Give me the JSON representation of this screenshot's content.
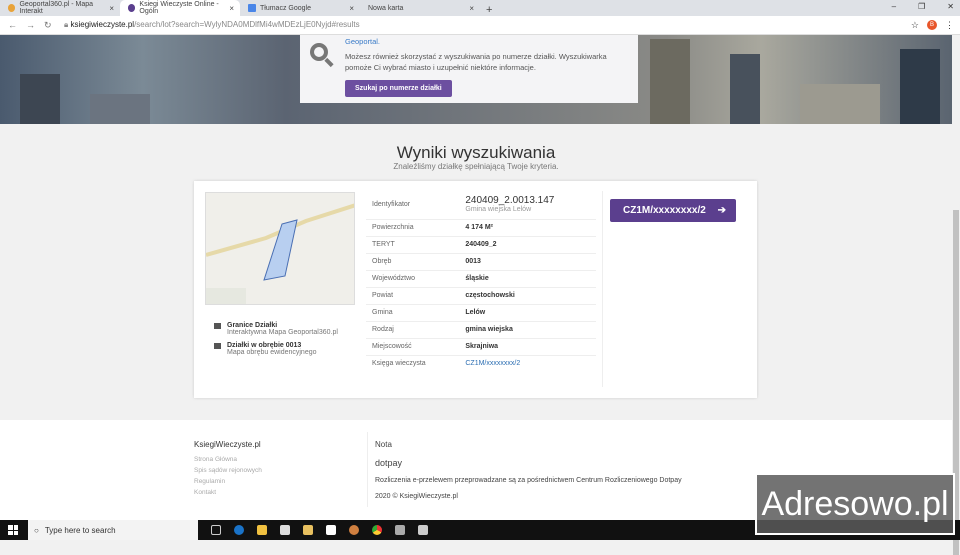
{
  "browser": {
    "tabs": [
      {
        "label": "Geoportal360.pl - Mapa Interakt",
        "favicon_color": "#e8a33a"
      },
      {
        "label": "Ksiegi Wieczyste Online - Ogóln",
        "favicon_color": "#5b3f8e"
      },
      {
        "label": "Tłumacz Google",
        "favicon_color": "#4a86e8"
      },
      {
        "label": "Nowa karta",
        "favicon_color": ""
      }
    ],
    "url_domain": "ksiegiwieczyste.pl",
    "url_path": "/search/lot?search=WylyNDA0MDlfMi4wMDEzLjE0Nyjd#results",
    "avatar": "B"
  },
  "search_box": {
    "geoportal_link": "Geoportal.",
    "text": "Możesz również skorzystać z wyszukiwania po numerze działki. Wyszukiwarka pomoże Ci wybrać miasto i uzupełnić niektóre informacje.",
    "button": "Szukaj po numerze działki"
  },
  "results": {
    "title": "Wyniki wyszukiwania",
    "subtitle": "Znaleźliśmy działkę spełniającą Twoje kryteria.",
    "id_label": "Identyfikator",
    "id_value": "240409_2.0013.147",
    "id_sub": "Gmina wiejska Lelów",
    "rows": [
      {
        "label": "Powierzchnia",
        "value": "4 174 M²"
      },
      {
        "label": "TERYT",
        "value": "240409_2"
      },
      {
        "label": "Obręb",
        "value": "0013"
      },
      {
        "label": "Województwo",
        "value": "śląskie"
      },
      {
        "label": "Powiat",
        "value": "częstochowski"
      },
      {
        "label": "Gmina",
        "value": "Lelów"
      },
      {
        "label": "Rodzaj",
        "value": "gmina wiejska"
      },
      {
        "label": "Miejscowość",
        "value": "Skrajniwa"
      }
    ],
    "kw_label": "Księga wieczysta",
    "kw_value": "CZ1M/xxxxxxxx/2",
    "kw_button": "CZ1M/xxxxxxxx/2",
    "links": [
      {
        "title": "Granice Działki",
        "sub": "Interaktywna Mapa Geoportal360.pl"
      },
      {
        "title": "Działki w obrębie 0013",
        "sub": "Mapa obrębu ewidencyjnego"
      }
    ]
  },
  "footer": {
    "brand": "KsiegiWieczyste.pl",
    "links": [
      "Strona Główna",
      "Spis sądów rejonowych",
      "Regulamin",
      "Kontakt"
    ],
    "nota": "Nota",
    "dotpay": "dotpay",
    "info": "Rozliczenia e-przelewem przeprowadzane są za pośrednictwem Centrum Rozliczeniowego Dotpay",
    "copyright": "2020 © KsiegiWieczyste.pl"
  },
  "taskbar": {
    "search_placeholder": "Type here to search"
  },
  "watermark": "Adresowo.pl",
  "colors": {
    "accent": "#5b3f8e",
    "link": "#2d6fb3"
  }
}
